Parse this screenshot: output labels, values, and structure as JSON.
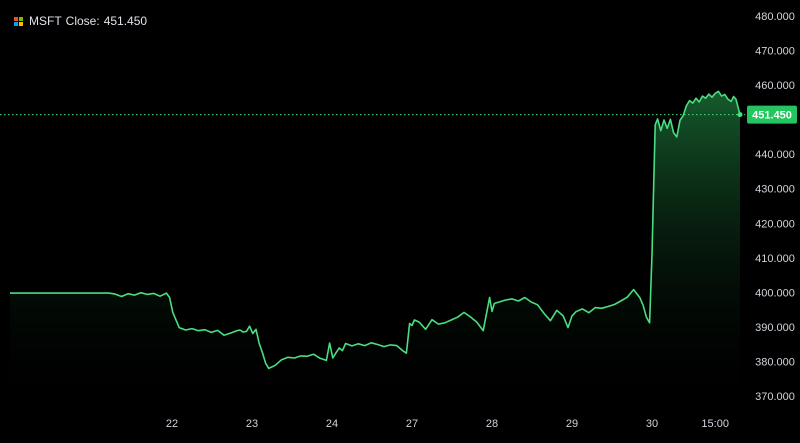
{
  "legend": {
    "symbol": "MSFT",
    "label": "Close:",
    "value": "451.450",
    "icon": "microsoft-logo-icon",
    "logo_colors": [
      "#f25022",
      "#7fba00",
      "#00a4ef",
      "#ffb900"
    ]
  },
  "colors": {
    "background": "#000000",
    "line": "#4ade80",
    "area_top": "#1a6b35",
    "last_price_label_bg": "#22c55e",
    "axis_text": "#d1d4dc"
  },
  "chart_data": {
    "type": "area",
    "title": "",
    "xlabel": "",
    "ylabel": "",
    "ylim": [
      365,
      482
    ],
    "grid": false,
    "y_ticks": [
      "370.000",
      "380.000",
      "390.000",
      "400.000",
      "410.000",
      "420.000",
      "430.000",
      "440.000",
      "450.000",
      "460.000",
      "470.000",
      "480.000"
    ],
    "x_ticks": [
      {
        "label": "22",
        "x": 21.5
      },
      {
        "label": "23",
        "x": 31.5
      },
      {
        "label": "24",
        "x": 41.5
      },
      {
        "label": "27",
        "x": 51.5
      },
      {
        "label": "28",
        "x": 61.5
      },
      {
        "label": "29",
        "x": 71.5
      },
      {
        "label": "30",
        "x": 81.5
      },
      {
        "label": "15:00",
        "x": 89.4
      }
    ],
    "last_price": {
      "value": 451.45,
      "label": "451.450"
    },
    "series": [
      {
        "x": [
          13.6,
          14.4,
          15.2,
          16.0,
          16.8,
          17.6,
          18.4,
          19.2,
          20.0,
          20.8,
          21.2,
          21.6,
          22.4,
          23.2,
          24.0,
          24.8,
          25.6,
          26.4,
          27.2,
          28.0,
          28.8,
          29.6,
          30.0,
          30.4,
          30.8,
          31.2,
          31.6,
          32.0,
          32.4,
          32.8,
          33.2,
          33.6,
          34.4,
          35.2,
          36.0,
          36.8,
          37.6,
          38.4,
          39.2,
          40.0,
          40.8,
          41.2,
          41.6,
          42.0,
          42.4,
          42.8,
          43.2,
          44.0,
          44.8,
          45.6,
          46.4,
          47.2,
          48.0,
          48.8,
          49.6,
          50.4,
          50.8,
          51.2,
          51.5,
          51.8,
          52.4,
          53.2,
          54.0,
          54.8,
          55.6,
          56.4,
          57.2,
          58.0,
          58.8,
          59.6,
          60.4,
          61.2,
          61.5,
          61.8,
          62.4,
          63.2,
          64.0,
          64.8,
          65.6,
          66.4,
          67.2,
          68.0,
          68.8,
          69.6,
          70.4,
          71.0,
          71.5,
          72.0,
          72.8,
          73.6,
          74.4,
          75.2,
          76.0,
          76.8,
          77.6,
          78.4,
          79.2,
          80.0,
          80.4,
          80.8,
          81.2,
          81.5,
          81.7,
          81.9,
          82.2,
          82.6,
          83.0,
          83.4,
          83.8,
          84.2,
          84.6,
          85.0,
          85.4,
          85.8,
          86.2,
          86.6,
          87.0,
          87.4,
          87.8,
          88.2,
          88.6,
          89.0,
          89.4,
          89.8,
          90.2,
          90.6,
          91.0,
          91.4,
          91.7,
          92.0,
          92.3,
          92.5
        ],
        "y": [
          399.8,
          399.5,
          398.8,
          399.6,
          399.2,
          399.9,
          399.4,
          399.7,
          398.9,
          399.8,
          398.5,
          394.2,
          389.8,
          389.1,
          389.5,
          388.9,
          389.2,
          388.4,
          389.0,
          387.6,
          388.2,
          388.9,
          389.1,
          388.5,
          388.7,
          390.2,
          388.1,
          389.3,
          385.2,
          382.6,
          379.5,
          378.0,
          378.9,
          380.5,
          381.2,
          381.0,
          381.6,
          381.5,
          382.1,
          380.9,
          380.3,
          385.3,
          381.0,
          382.5,
          383.9,
          383.1,
          385.2,
          384.5,
          385.1,
          384.6,
          385.4,
          384.9,
          384.3,
          384.8,
          384.6,
          383.0,
          382.4,
          391.0,
          390.4,
          392.0,
          391.4,
          389.3,
          392.1,
          390.8,
          391.2,
          392.0,
          392.8,
          394.2,
          392.9,
          391.4,
          388.9,
          398.5,
          394.5,
          396.8,
          397.2,
          397.8,
          398.1,
          397.5,
          398.5,
          397.2,
          396.4,
          393.9,
          391.8,
          394.8,
          393.2,
          389.8,
          393.2,
          394.4,
          395.2,
          394.1,
          395.6,
          395.4,
          395.9,
          396.5,
          397.5,
          398.6,
          400.8,
          398.4,
          396.2,
          392.8,
          391.2,
          411.0,
          430.0,
          448.5,
          450.2,
          446.8,
          449.9,
          447.5,
          450.1,
          446.2,
          445.0,
          449.8,
          451.2,
          454.0,
          455.5,
          454.8,
          456.2,
          455.1,
          456.8,
          456.2,
          457.4,
          456.5,
          457.6,
          458.2,
          456.8,
          457.3,
          455.9,
          455.3,
          456.7,
          455.9,
          453.2,
          451.45
        ]
      }
    ]
  }
}
